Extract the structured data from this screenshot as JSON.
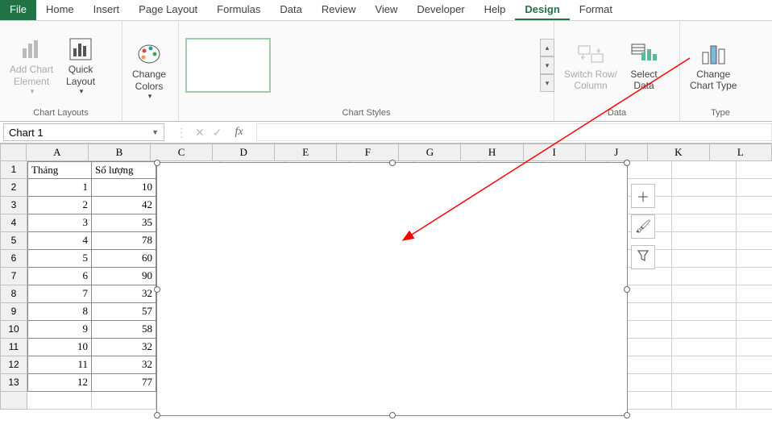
{
  "tabs": [
    "File",
    "Home",
    "Insert",
    "Page Layout",
    "Formulas",
    "Data",
    "Review",
    "View",
    "Developer",
    "Help",
    "Design",
    "Format"
  ],
  "active_tab": "Design",
  "ribbon": {
    "add_chart_element": "Add Chart\nElement",
    "quick_layout": "Quick\nLayout",
    "change_colors": "Change\nColors",
    "switch_row_col": "Switch Row/\nColumn",
    "select_data": "Select\nData",
    "change_chart_type": "Change\nChart Type",
    "group_chart_layouts": "Chart Layouts",
    "group_chart_styles": "Chart Styles",
    "group_data": "Data",
    "group_type": "Type"
  },
  "name_box": "Chart 1",
  "columns": [
    "A",
    "B",
    "C",
    "D",
    "E",
    "F",
    "G",
    "H",
    "I",
    "J",
    "K",
    "L"
  ],
  "table": {
    "headers": [
      "Tháng",
      "Số lượng"
    ],
    "rows": [
      [
        1,
        10
      ],
      [
        2,
        42
      ],
      [
        3,
        35
      ],
      [
        4,
        78
      ],
      [
        5,
        60
      ],
      [
        6,
        90
      ],
      [
        7,
        32
      ],
      [
        8,
        57
      ],
      [
        9,
        58
      ],
      [
        10,
        32
      ],
      [
        11,
        32
      ],
      [
        12,
        77
      ]
    ]
  },
  "row_count": 13,
  "chart_tool_icons": {
    "plus": "plus-icon",
    "brush": "brush-icon",
    "filter": "filter-icon"
  }
}
